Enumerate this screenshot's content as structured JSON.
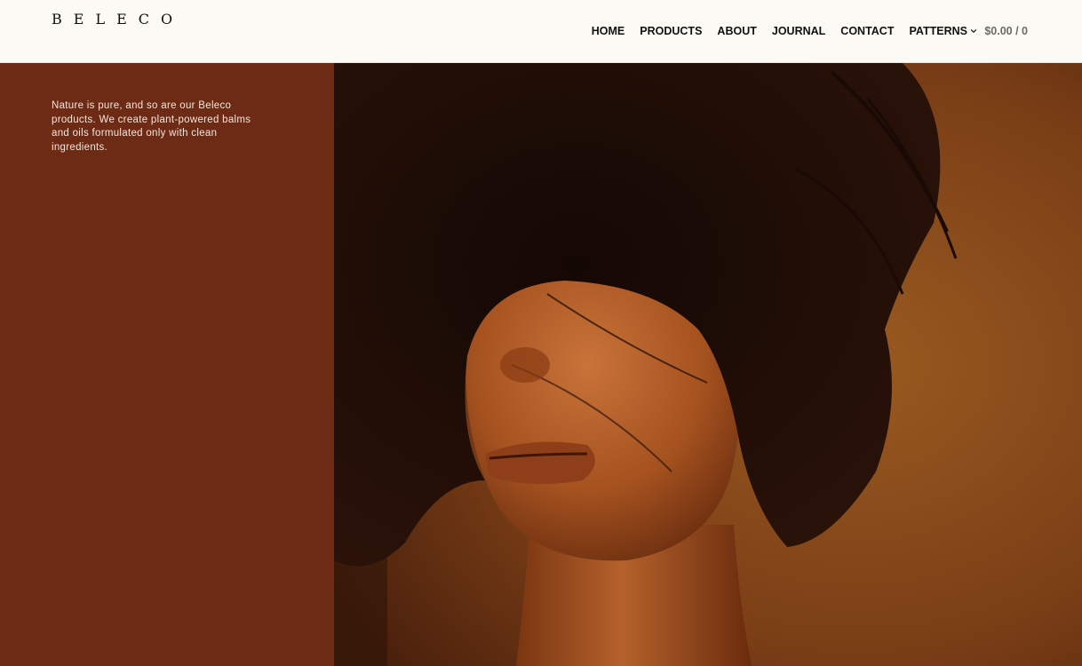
{
  "header": {
    "logo": "BELECO",
    "nav": {
      "home": "HOME",
      "products": "PRODUCTS",
      "about": "ABOUT",
      "journal": "JOURNAL",
      "contact": "CONTACT",
      "patterns": "PATTERNS"
    },
    "cart": "$0.00 / 0"
  },
  "intro": {
    "text": "Nature is pure, and so are our Beleco products. We create plant-powered balms and oils formulated only with clean ingredients."
  },
  "colors": {
    "header_bg": "#fbfaf5",
    "panel_bg": "#6d2a15",
    "hero_tone": "#8a4a18"
  },
  "icons": {
    "patterns_dropdown": "chevron-down-icon"
  }
}
